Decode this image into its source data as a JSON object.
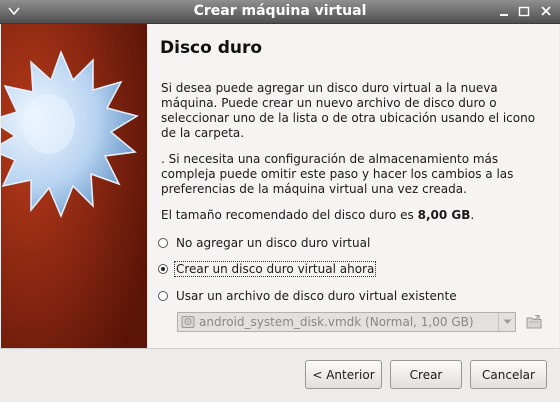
{
  "window": {
    "title": "Crear máquina virtual"
  },
  "content": {
    "heading": "Disco duro",
    "paragraph1_lines": [
      "Si desea puede agregar un disco duro virtual a la nueva",
      "máquina. Puede crear un nuevo archivo de disco duro o",
      "seleccionar uno de la lista o de otra ubicación usando el icono",
      "de la carpeta."
    ],
    "paragraph2_lines": [
      ". Si necesita una configuración de almacenamiento más",
      "compleja puede omitir este paso y hacer los cambios a las",
      "preferencias de la máquina virtual una vez creada."
    ],
    "recommended_prefix": "El tamaño recomendado del disco duro es ",
    "recommended_size": "8,00 GB",
    "recommended_suffix": "."
  },
  "options": [
    {
      "label": "No agregar un disco duro virtual",
      "selected": false
    },
    {
      "label": "Crear un disco duro virtual ahora",
      "selected": true
    },
    {
      "label": "Usar un archivo de disco duro virtual existente",
      "selected": false
    }
  ],
  "existing_disk": {
    "value": "android_system_disk.vmdk (Normal, 1,00 GB)",
    "enabled": false
  },
  "buttons": {
    "back": "< Anterior",
    "create": "Crear",
    "cancel": "Cancelar"
  },
  "colors": {
    "titlebar": "#5e5e5e",
    "art_background": "#7a1e0c",
    "art_star": "#bcd6f2"
  }
}
